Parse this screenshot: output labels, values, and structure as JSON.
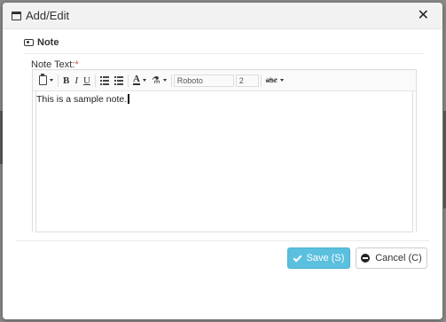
{
  "dialog": {
    "title": "Add/Edit",
    "close_glyph": "✕"
  },
  "section": {
    "title": "Note"
  },
  "field": {
    "label": "Note Text:",
    "required_mark": "*"
  },
  "toolbar": {
    "bold": "B",
    "italic": "I",
    "underline": "U",
    "font_color": "A",
    "font_name": "Roboto",
    "font_size": "2",
    "spellcheck": "abc"
  },
  "editor": {
    "content": "This is a sample note."
  },
  "buttons": {
    "save": "Save (S)",
    "cancel": "Cancel (C)"
  },
  "colors": {
    "save_button": "#5bc0de",
    "required": "#d9534f"
  }
}
